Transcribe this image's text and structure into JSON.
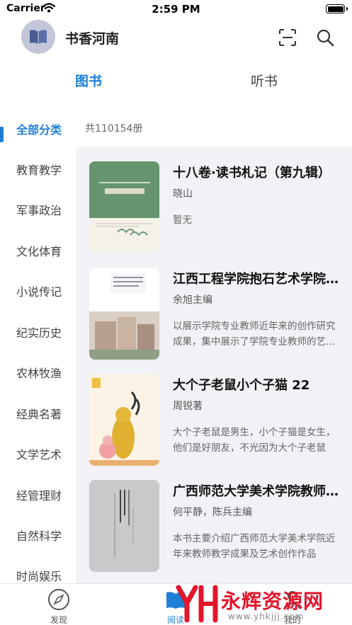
{
  "status_bar": {
    "carrier": "Carrier",
    "time": "2:59 PM"
  },
  "header": {
    "library_name": "书香河南"
  },
  "tabs": [
    {
      "label": "图书",
      "selected": true
    },
    {
      "label": "听书",
      "selected": false
    }
  ],
  "categories": [
    {
      "label": "全部分类",
      "active": true
    },
    {
      "label": "教育教学"
    },
    {
      "label": "军事政治"
    },
    {
      "label": "文化体育"
    },
    {
      "label": "小说传记"
    },
    {
      "label": "纪实历史"
    },
    {
      "label": "农林牧渔"
    },
    {
      "label": "经典名著"
    },
    {
      "label": "文学艺术"
    },
    {
      "label": "经管理财"
    },
    {
      "label": "自然科学"
    },
    {
      "label": "时尚娱乐"
    }
  ],
  "total_count": "共110154册",
  "books": [
    {
      "title": "十八卷·读书札记（第九辑）",
      "author": "晓山",
      "description": "暂无"
    },
    {
      "title": "江西工程学院抱石艺术学院教师作品集",
      "author": "余旭主编",
      "description": "以展示学院专业教师近年来的创作研究成果，集中展示了学院专业教师的艺术风采"
    },
    {
      "title": "大个子老鼠小个子猫 22",
      "author": "周锐著",
      "description": "大个子老鼠是男生，小个子猫是女生，他们是好朋友，不光因为大个子老鼠"
    },
    {
      "title": "广西师范大学美术学院教师作品集",
      "author": "何平静，陈兵主编",
      "description": "本书主要介绍广西师范大学美术学院近年来教师教学成果及艺术创作作品"
    }
  ],
  "tab_bar": {
    "discover": "发现",
    "read": "阅读",
    "mine": "我的"
  },
  "watermark": {
    "text": "永辉资源网",
    "url": "www.yhkjjj.com"
  },
  "colors": {
    "accent": "#1f7fd6",
    "list_bg": "#f1f1f6",
    "watermark": "#e3152b"
  }
}
